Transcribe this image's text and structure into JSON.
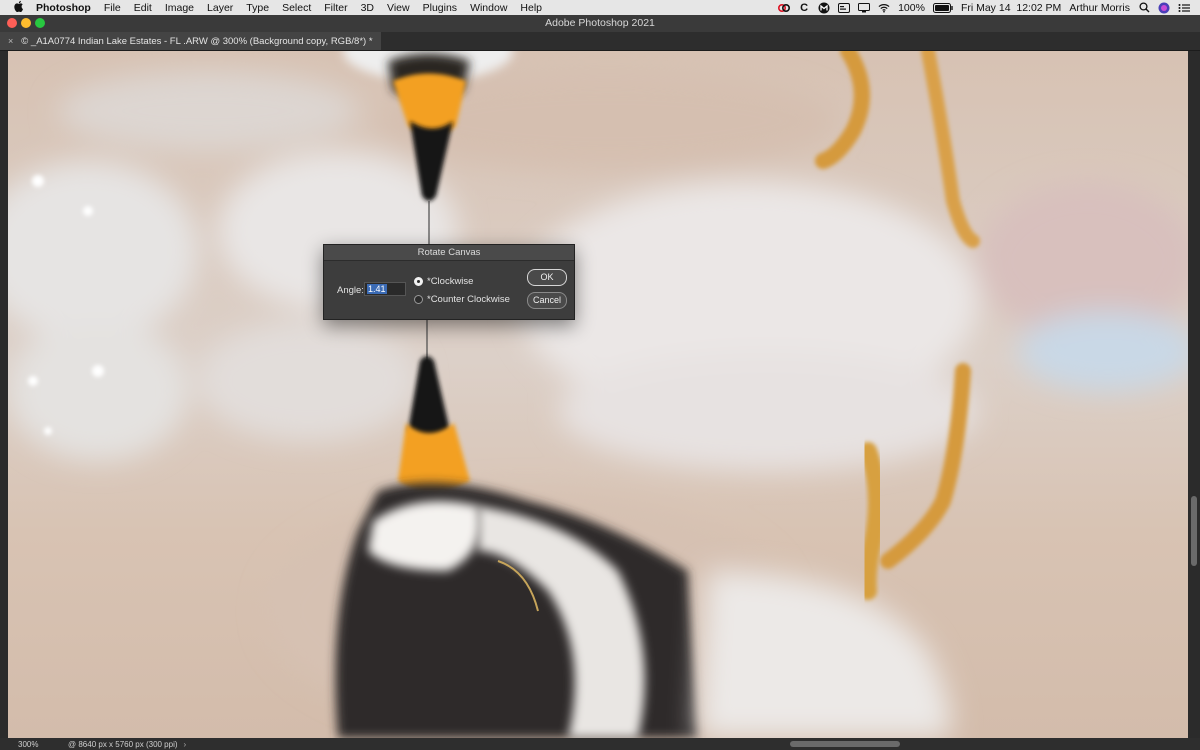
{
  "menubar": {
    "apple": "",
    "app_name": "Photoshop",
    "items": [
      "File",
      "Edit",
      "Image",
      "Layer",
      "Type",
      "Select",
      "Filter",
      "3D",
      "View",
      "Plugins",
      "Window",
      "Help"
    ],
    "status": {
      "battery": "100%",
      "datetime": "Fri May 14  12:02 PM",
      "user": "Arthur Morris"
    }
  },
  "titlebar": {
    "title": "Adobe Photoshop 2021"
  },
  "tab": {
    "label": "© _A1A0774 Indian Lake Estates - FL .ARW @ 300% (Background copy, RGB/8*) *",
    "close": "×"
  },
  "dialog": {
    "title": "Rotate Canvas",
    "angle_label": "Angle:",
    "angle_value": "1.41",
    "option_cw": "*Clockwise",
    "option_ccw": "*Counter Clockwise",
    "ok_label": "OK",
    "cancel_label": "Cancel"
  },
  "statusbar": {
    "zoom": "300%",
    "doc_info": "@ 8640 px x 5760 px (300 ppi)",
    "caret": "›"
  }
}
